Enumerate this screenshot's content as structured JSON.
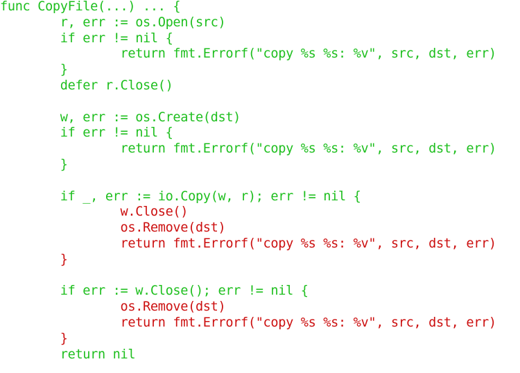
{
  "colors": {
    "green": "#1fbf1f",
    "red": "#cc1010",
    "background": "#ffffff"
  },
  "code_lines": [
    {
      "text": "func CopyFile(...) ... {",
      "color": "green"
    },
    {
      "text": "        r, err := os.Open(src)",
      "color": "green"
    },
    {
      "text": "        if err != nil {",
      "color": "green"
    },
    {
      "text": "                return fmt.Errorf(\"copy %s %s: %v\", src, dst, err)",
      "color": "green"
    },
    {
      "text": "        }",
      "color": "green"
    },
    {
      "text": "        defer r.Close()",
      "color": "green"
    },
    {
      "text": "",
      "color": "green"
    },
    {
      "text": "        w, err := os.Create(dst)",
      "color": "green"
    },
    {
      "text": "        if err != nil {",
      "color": "green"
    },
    {
      "text": "                return fmt.Errorf(\"copy %s %s: %v\", src, dst, err)",
      "color": "green"
    },
    {
      "text": "        }",
      "color": "green"
    },
    {
      "text": "",
      "color": "green"
    },
    {
      "text": "        if _, err := io.Copy(w, r); err != nil {",
      "color": "green"
    },
    {
      "text": "                w.Close()",
      "color": "red"
    },
    {
      "text": "                os.Remove(dst)",
      "color": "red"
    },
    {
      "text": "                return fmt.Errorf(\"copy %s %s: %v\", src, dst, err)",
      "color": "red"
    },
    {
      "text": "        }",
      "color": "red"
    },
    {
      "text": "",
      "color": "green"
    },
    {
      "text": "        if err := w.Close(); err != nil {",
      "color": "green"
    },
    {
      "text": "                os.Remove(dst)",
      "color": "red"
    },
    {
      "text": "                return fmt.Errorf(\"copy %s %s: %v\", src, dst, err)",
      "color": "red"
    },
    {
      "text": "        }",
      "color": "red"
    },
    {
      "text": "        return nil",
      "color": "green"
    }
  ]
}
